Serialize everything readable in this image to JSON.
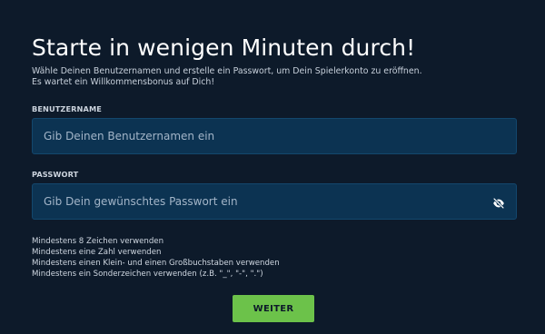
{
  "form": {
    "title": "Starte in wenigen Minuten durch!",
    "subtitle_line1": "Wähle Deinen Benutzernamen und erstelle ein Passwort, um Dein Spielerkonto zu eröffnen.",
    "subtitle_line2": "Es wartet ein Willkommensbonus auf Dich!",
    "username": {
      "label": "BENUTZERNAME",
      "placeholder": "Gib Deinen Benutzernamen ein",
      "value": ""
    },
    "password": {
      "label": "PASSWORT",
      "placeholder": "Gib Dein gewünschtes Passwort ein",
      "value": "",
      "toggle_icon": "eye-slash-icon"
    },
    "rules": [
      "Mindestens 8 Zeichen verwenden",
      "Mindestens eine Zahl verwenden",
      "Mindestens einen Klein- und einen Großbuchstaben verwenden",
      "Mindestens ein Sonderzeichen verwenden (z.B. \"_\", \"-\", \".\")"
    ],
    "submit_label": "WEITER"
  },
  "colors": {
    "background": "#0d1a2a",
    "input_background": "#0c3352",
    "accent": "#6cc24a"
  }
}
